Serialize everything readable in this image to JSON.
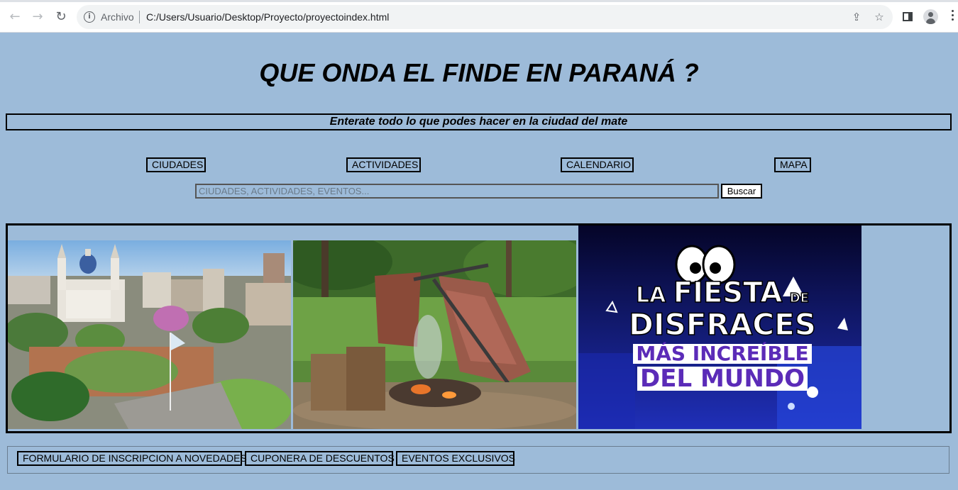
{
  "browser": {
    "back_icon": "arrow-left-icon",
    "forward_icon": "arrow-right-icon",
    "reload_icon": "reload-icon",
    "security_label": "Archivo",
    "url": "C:/Users/Usuario/Desktop/Proyecto/proyectoindex.html"
  },
  "page": {
    "title": "QUE ONDA EL FINDE EN PARANÁ ?",
    "subtitle": "Enterate todo lo que podes hacer en la ciudad del mate",
    "nav": [
      "CIUDADES",
      "ACTIVIDADES",
      "CALENDARIO",
      "MAPA"
    ],
    "search": {
      "placeholder": "CIUDADES, ACTIVIDADES, EVENTOS...",
      "button": "Buscar"
    },
    "gallery": [
      {
        "subject": "parana-city-aerial-photo"
      },
      {
        "subject": "asado-photo"
      },
      {
        "subject": "fiesta-disfraces-poster",
        "lines": [
          "LA",
          "FIESTA",
          "DE",
          "DISFRACES",
          "MÁS INCREÍBLE",
          "DEL MUNDO"
        ]
      }
    ],
    "footer_links": [
      "FORMULARIO DE INSCRIPCION A NOVEDADES",
      "CUPONERA DE DESCUENTOS",
      "EVENTOS EXCLUSIVOS"
    ]
  },
  "colors": {
    "page_background": "#9dbbd9",
    "poster_background": "#0a0a3a",
    "poster_text": "#ffffff",
    "poster_accent": "#5b2bb8"
  }
}
